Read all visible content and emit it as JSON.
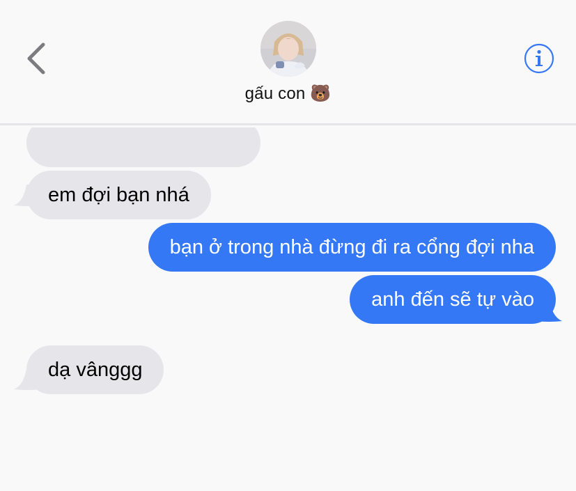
{
  "header": {
    "contact_name": "gấu con 🐻",
    "back_icon": "chevron-left-icon",
    "info_icon": "info-circle-icon"
  },
  "colors": {
    "incoming_bubble": "#e5e5ea",
    "outgoing_bubble": "#3478f6",
    "accent": "#3478f6",
    "background": "#f9f9f9"
  },
  "messages": [
    {
      "direction": "incoming",
      "text": ""
    },
    {
      "direction": "incoming",
      "text": "em đợi bạn nhá"
    },
    {
      "direction": "outgoing",
      "text": "bạn ở trong nhà đừng đi ra cổng đợi nha"
    },
    {
      "direction": "outgoing",
      "text": "anh đến sẽ tự vào"
    },
    {
      "direction": "incoming",
      "text": "dạ vânggg"
    }
  ]
}
